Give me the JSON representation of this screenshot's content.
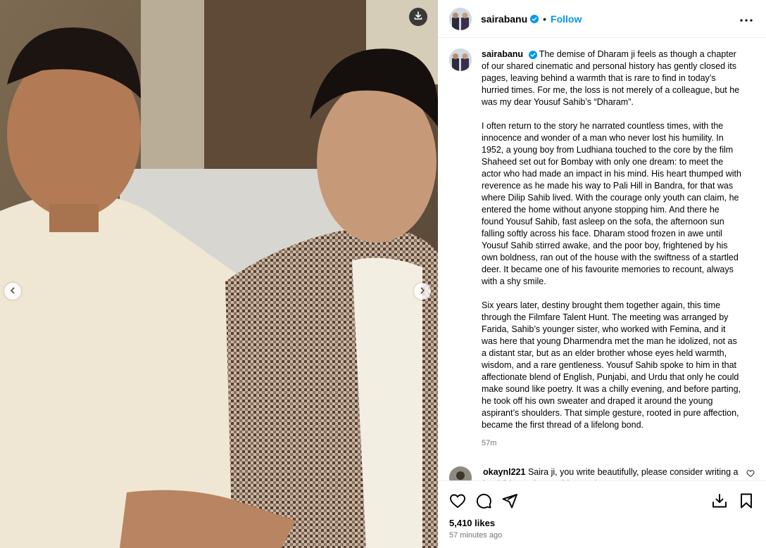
{
  "post": {
    "username": "sairabanu",
    "follow_label": "Follow",
    "separator": "•"
  },
  "caption": {
    "username": "sairabanu",
    "paragraphs": [
      "The demise of Dharam ji feels as though a chapter of our shared cinematic and personal history has gently closed its pages, leaving behind a warmth that is rare to find in today’s hurried times. For me, the loss is not merely of a colleague, but he was my dear Yousuf Sahib’s “Dharam”.",
      "I often return to the story he narrated countless times, with the innocence and wonder of a man who never lost his humility. In 1952, a young boy from Ludhiana touched to the core by the film Shaheed set out for Bombay with only one dream: to meet the actor who had made an impact in his mind. His heart thumped with reverence as he made his way to Pali Hill in Bandra, for that was where Dilip Sahib lived. With the courage only youth can claim, he entered the home without anyone stopping him. And there he found Yousuf Sahib, fast asleep on the sofa, the afternoon sun falling softly across his face. Dharam stood frozen in awe until Yousuf Sahib stirred awake, and the poor boy, frightened by his own boldness, ran out of the house with the swiftness of a startled deer. It became one of his favourite memories to recount, always with a shy smile.",
      "Six years later, destiny brought them together again, this time through the Filmfare Talent Hunt. The meeting was arranged by Farida, Sahib’s younger sister, who worked with Femina, and it was here that young Dharmendra met the man he idolized, not as a distant star, but as an elder brother whose eyes held warmth, wisdom, and a rare gentleness. Yousuf Sahib spoke to him in that affectionate blend of English, Punjabi, and Urdu that only he could make sound like poetry. It was a chilly evening, and before parting, he took off his own sweater and draped it around the young aspirant’s shoulders. That simple gesture, rooted in pure affection, became the first thread of a lifelong bond."
    ],
    "time": "57m"
  },
  "comment": {
    "username": "okaynl221",
    "text": "Saira ji, you write beautifully, please consider writing a book/biography anything. Salam."
  },
  "footer": {
    "likes": "5,410 likes",
    "posted": "57 minutes ago"
  },
  "colors": {
    "accent": "#0095f6",
    "verified": "#0095f6",
    "secondary_text": "#737373",
    "divider": "#efefef"
  },
  "icons": {
    "download": "download-icon",
    "prev": "chevron-left-icon",
    "next": "chevron-right-icon",
    "more": "more-options-icon",
    "like": "heart-icon",
    "comment": "comment-icon",
    "share": "share-icon",
    "save_media": "save-to-device-icon",
    "bookmark": "bookmark-icon"
  }
}
